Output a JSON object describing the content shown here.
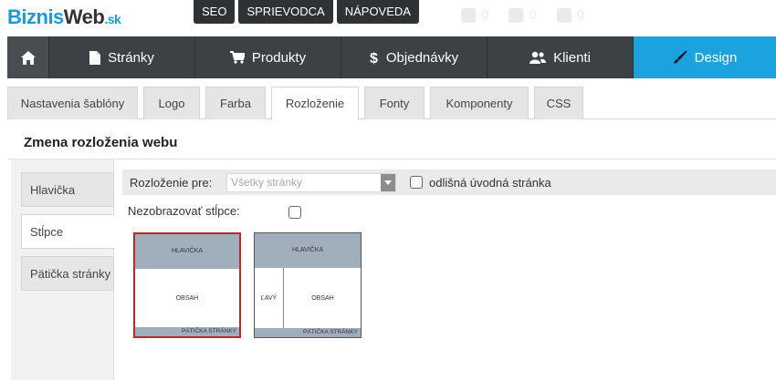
{
  "brand": {
    "part1": "Biznis",
    "part2": "Web",
    "part3": ".sk"
  },
  "toplinks": [
    "SEO",
    "SPRIEVODCA",
    "NÁPOVEDA"
  ],
  "topicons": [
    {
      "icon": "user-icon",
      "count": "0"
    },
    {
      "icon": "cart-icon",
      "count": "0"
    },
    {
      "icon": "notification-icon",
      "count": "0"
    }
  ],
  "mainnav": [
    {
      "label": "Stránky",
      "icon": "page-icon"
    },
    {
      "label": "Produkty",
      "icon": "cart-icon"
    },
    {
      "label": "Objednávky",
      "icon": "dollar-icon"
    },
    {
      "label": "Klienti",
      "icon": "users-icon"
    },
    {
      "label": "Design",
      "icon": "brush-icon"
    }
  ],
  "tabs": [
    "Nastavenia šablóny",
    "Logo",
    "Farba",
    "Rozloženie",
    "Fonty",
    "Komponenty",
    "CSS"
  ],
  "active_tab": "Rozloženie",
  "page_title": "Zmena rozloženia webu",
  "sidenav": [
    "Hlavička",
    "Stĺpce",
    "Pätička stránky"
  ],
  "active_sidenav": "Stĺpce",
  "form": {
    "layout_for_label": "Rozloženie pre:",
    "layout_for_value": "Všetky stránky",
    "different_home_label": "odlišná úvodná stránka",
    "hide_columns_label": "Nezobrazovať stĺpce:"
  },
  "layouts": [
    {
      "header": "HLAVIČKA",
      "content": "OBSAH",
      "footer": "PÄTIČKA STRÁNKY",
      "selected": true
    },
    {
      "header": "HLAVIČKA",
      "left": "ĽAVÝ",
      "content": "OBSAH",
      "footer": "PÄTIČKA STRÁNKY",
      "selected": false
    }
  ],
  "colors": {
    "accent": "#1ba3e0",
    "nav_bg": "#3b4144",
    "selected_border": "#c0262c",
    "thumb_block": "#a1afbd"
  }
}
